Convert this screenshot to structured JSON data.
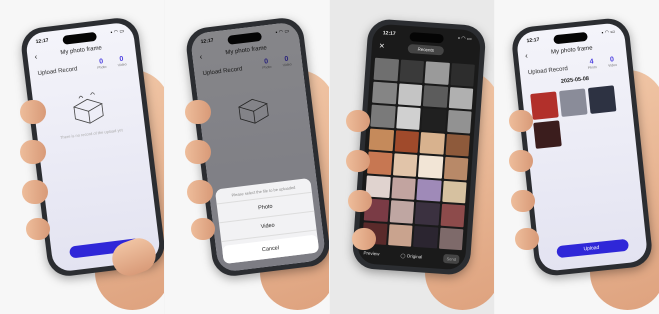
{
  "panels": [
    {
      "status": {
        "time": "12:17",
        "icons": "▪ ◠ ▭"
      },
      "nav": {
        "title": "My photo frame"
      },
      "subtitle": "Upload Record",
      "counts": [
        {
          "value": "0",
          "label": "Photo"
        },
        {
          "value": "0",
          "label": "Video"
        }
      ],
      "empty_text": "There is no record of the upload yet",
      "button": ""
    },
    {
      "status": {
        "time": "12:17",
        "icons": "▪ ◠ ▭"
      },
      "nav": {
        "title": "My photo frame"
      },
      "subtitle": "Upload Record",
      "counts": [
        {
          "value": "0",
          "label": "Photo"
        },
        {
          "value": "0",
          "label": "Video"
        }
      ],
      "sheet": {
        "title": "Please select the file to be uploaded",
        "options": [
          "Photo",
          "Video"
        ],
        "cancel": "Cancel"
      }
    },
    {
      "status": {
        "time": "12:17",
        "icons": "▪ ◠ ▭"
      },
      "gallery": {
        "title": "Recents",
        "preview": "Preview",
        "original": "◯ Original",
        "send": "Send"
      },
      "tiles": [
        "#6f6f6f",
        "#3a3a3a",
        "#9a9a9a",
        "#2d2d2d",
        "#858585",
        "#c4c4c4",
        "#5c5c5c",
        "#b0b0b0",
        "#7a7a7a",
        "#d0d0d0",
        "#202020",
        "#929292",
        "#c58a5b",
        "#a04a2b",
        "#d8b28e",
        "#8e5a3b",
        "#c77752",
        "#e1c4a9",
        "#f2e5d6",
        "#b88968",
        "#e0d3cf",
        "#c2a4a0",
        "#9f8ab8",
        "#d6c1a0",
        "#7a3b45",
        "#bfa6a2",
        "#3b3140",
        "#8d4b4b",
        "#5a2a2a",
        "#c9a38e",
        "#2b2530",
        "#7e6a6a"
      ]
    },
    {
      "status": {
        "time": "12:17",
        "icons": "▪ ◠ ▭"
      },
      "nav": {
        "title": "My photo frame"
      },
      "subtitle": "Upload Record",
      "counts": [
        {
          "value": "4",
          "label": "Photo"
        },
        {
          "value": "0",
          "label": "Video"
        }
      ],
      "date": "2025-05-08",
      "photos": [
        "#b2302b",
        "#8a8c99",
        "#2d3242",
        "#3b1d1d"
      ],
      "button": "Upload  "
    }
  ]
}
